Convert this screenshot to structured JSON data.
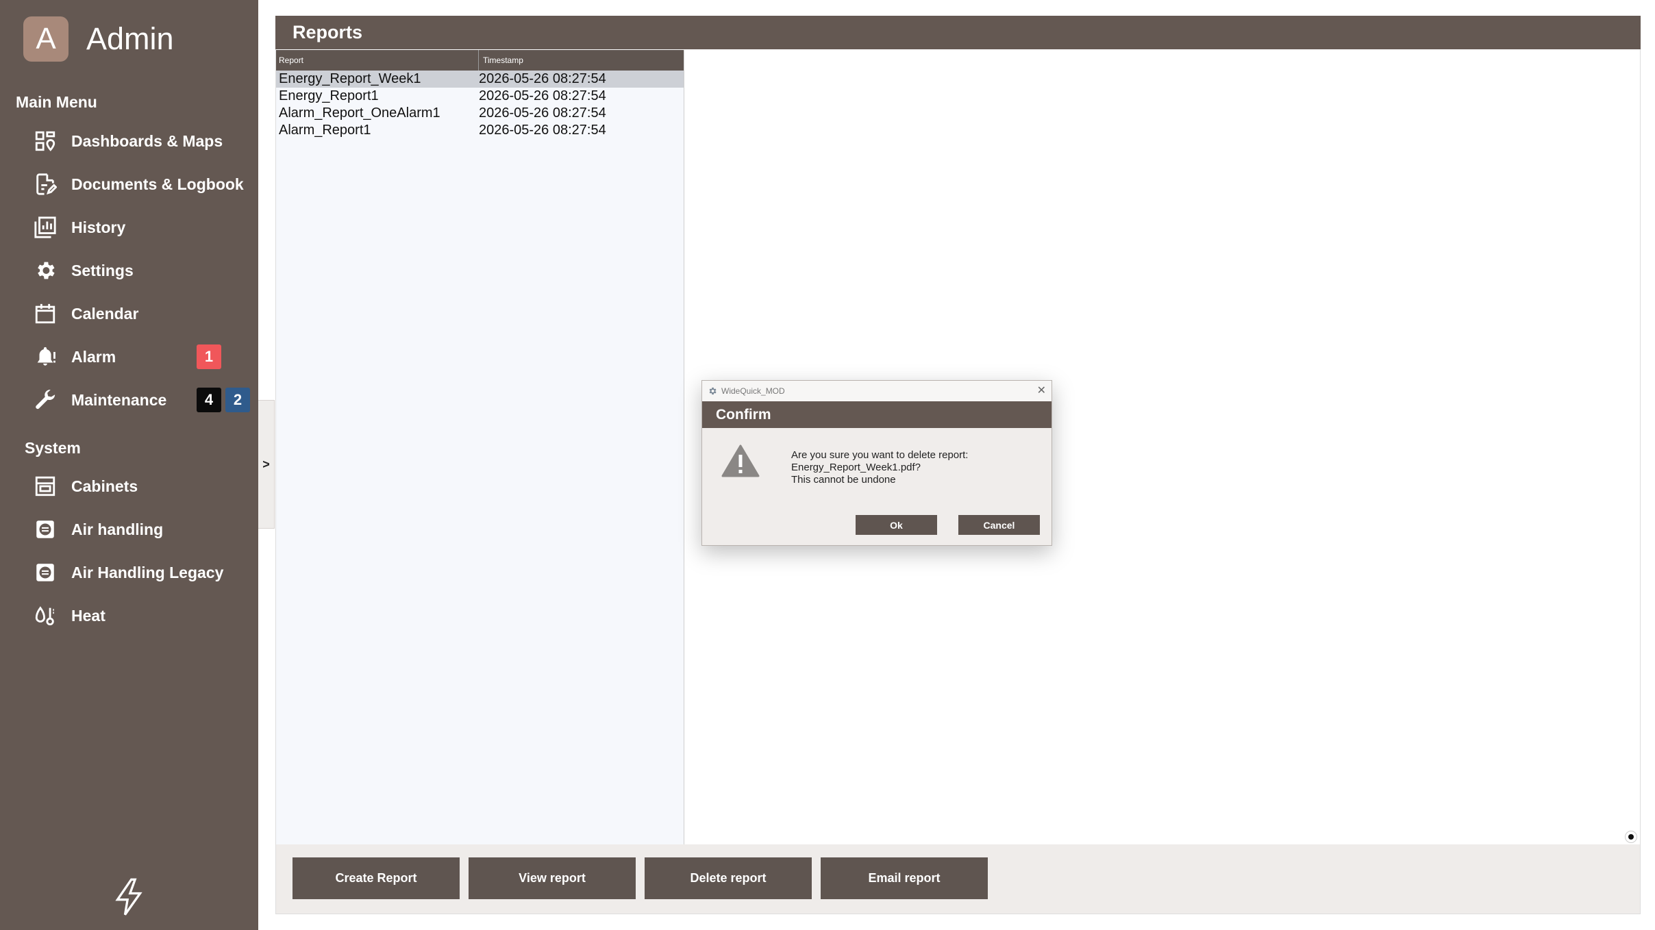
{
  "user": {
    "avatar_letter": "A",
    "name": "Admin"
  },
  "sidebar": {
    "main_menu_title": "Main Menu",
    "main_items": [
      {
        "label": "Dashboards & Maps",
        "icon": "dashboard-icon"
      },
      {
        "label": "Documents & Logbook",
        "icon": "document-edit-icon"
      },
      {
        "label": "History",
        "icon": "history-chart-icon"
      },
      {
        "label": "Settings",
        "icon": "gear-icon"
      },
      {
        "label": "Calendar",
        "icon": "calendar-icon"
      },
      {
        "label": "Alarm",
        "icon": "bell-alert-icon",
        "badges": [
          "1"
        ]
      },
      {
        "label": "Maintenance",
        "icon": "wrench-icon",
        "badges": [
          "4",
          "2"
        ]
      }
    ],
    "system_title": "System",
    "system_items": [
      {
        "label": "Cabinets",
        "icon": "cabinet-icon"
      },
      {
        "label": "Air handling",
        "icon": "air-handling-icon"
      },
      {
        "label": "Air Handling Legacy",
        "icon": "air-handling-icon"
      },
      {
        "label": "Heat",
        "icon": "heat-icon"
      }
    ],
    "collapse_label": ">",
    "badge_colors": {
      "alarm": "#f0575a",
      "maintenance_1": "#0b0b0b",
      "maintenance_2": "#2f5b8c"
    }
  },
  "reports": {
    "title": "Reports",
    "columns": [
      "Report",
      "Timestamp"
    ],
    "rows": [
      {
        "report": "Energy_Report_Week1",
        "timestamp": "2026-05-26 08:27:54",
        "selected": true
      },
      {
        "report": "Energy_Report1",
        "timestamp": "2026-05-26 08:27:54"
      },
      {
        "report": "Alarm_Report_OneAlarm1",
        "timestamp": "2026-05-26 08:27:54"
      },
      {
        "report": "Alarm_Report1",
        "timestamp": "2026-05-26 08:27:54"
      }
    ],
    "buttons": {
      "create": "Create Report",
      "view": "View report",
      "delete": "Delete report",
      "email": "Email report"
    }
  },
  "dialog": {
    "window_title": "WideQuick_MOD",
    "header": "Confirm",
    "message_line1": "Are you sure you want to delete report:",
    "message_line2": "Energy_Report_Week1.pdf?",
    "message_line3": "This cannot be undone",
    "ok": "Ok",
    "cancel": "Cancel"
  }
}
